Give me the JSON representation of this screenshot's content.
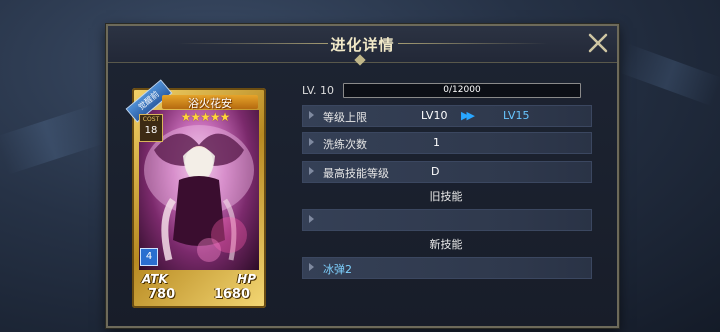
{
  "window": {
    "title": "进化详情"
  },
  "card": {
    "ribbon": "觉醒前",
    "name": "浴火花安",
    "stars": "★★★★★",
    "cost_label": "COST",
    "level": "18",
    "rarity_number": "4",
    "atk_label": "ATK",
    "atk_value": "780",
    "hp_label": "HP",
    "hp_value": "1680"
  },
  "details": {
    "lv_label": "LV. 10",
    "xp_text": "0/12000",
    "xp_progress": 0,
    "rows": [
      {
        "label": "等级上限",
        "from": "LV10",
        "arrow": "▶▶",
        "to": "LV15"
      },
      {
        "label": "洗练次数",
        "value": "1"
      },
      {
        "label": "最高技能等级",
        "value": "D"
      }
    ],
    "old_skills_title": "旧技能",
    "old_skill": "",
    "new_skills_title": "新技能",
    "new_skill": "冰弹2"
  },
  "colors": {
    "accent_blue": "#68c6ff",
    "gold": "#f3d36a",
    "frame": "#6d6a5a"
  },
  "icons": {
    "close": "close-icon",
    "row_arrow": "chevron-right-icon",
    "level_arrow": "double-arrow-icon"
  }
}
